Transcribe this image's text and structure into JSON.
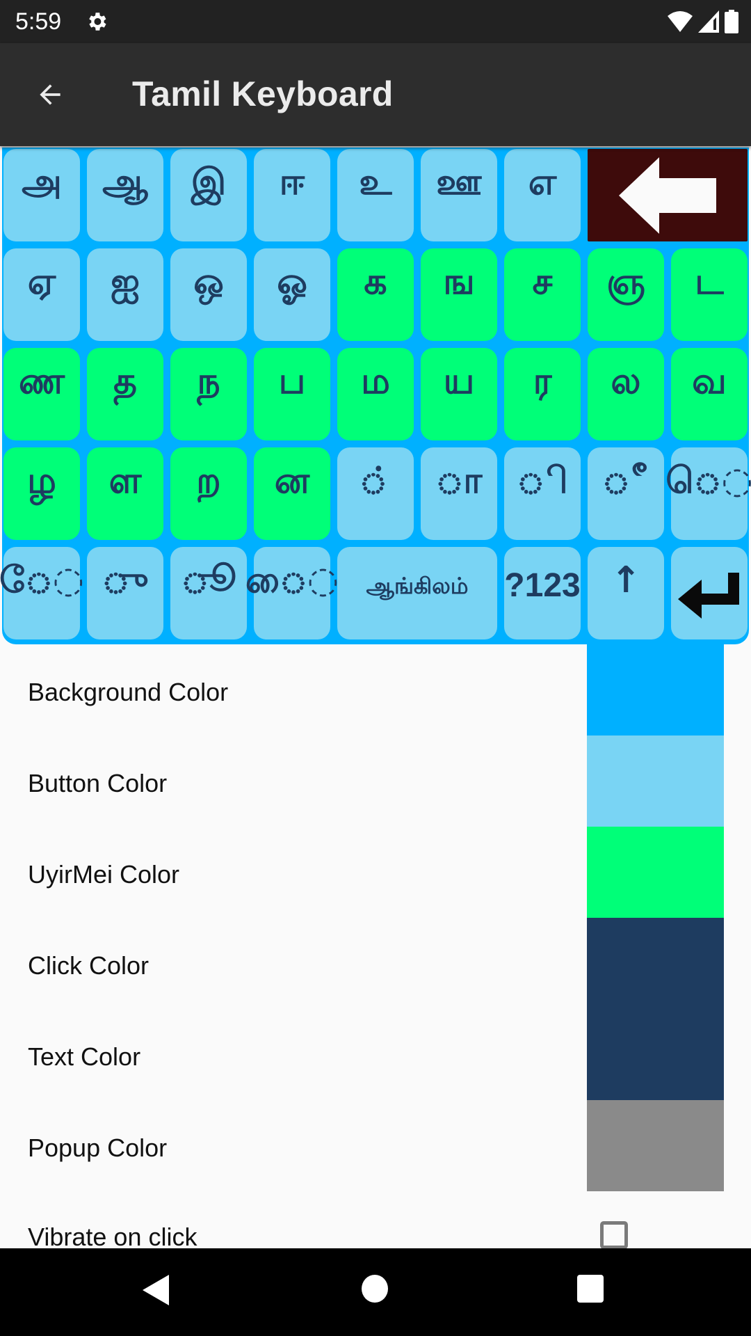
{
  "status_bar": {
    "time": "5:59",
    "icons": [
      "settings-gear-icon",
      "wifi-icon",
      "cell-signal-icon",
      "battery-icon"
    ]
  },
  "toolbar": {
    "title": "Tamil Keyboard",
    "back_icon": "arrow-back-icon"
  },
  "keyboard": {
    "rows": [
      [
        {
          "label": "அ",
          "type": "vowel"
        },
        {
          "label": "ஆ",
          "type": "vowel"
        },
        {
          "label": "இ",
          "type": "vowel"
        },
        {
          "label": "ஈ",
          "type": "vowel"
        },
        {
          "label": "உ",
          "type": "vowel"
        },
        {
          "label": "ஊ",
          "type": "vowel"
        },
        {
          "label": "எ",
          "type": "vowel"
        },
        {
          "label": "",
          "type": "delete",
          "icon": "backspace-arrow-icon"
        }
      ],
      [
        {
          "label": "ஏ",
          "type": "vowel"
        },
        {
          "label": "ஐ",
          "type": "vowel"
        },
        {
          "label": "ஒ",
          "type": "vowel"
        },
        {
          "label": "ஓ",
          "type": "vowel"
        },
        {
          "label": "க",
          "type": "uyirmei"
        },
        {
          "label": "ங",
          "type": "uyirmei"
        },
        {
          "label": "ச",
          "type": "uyirmei"
        },
        {
          "label": "ஞ",
          "type": "uyirmei"
        },
        {
          "label": "ட",
          "type": "uyirmei"
        }
      ],
      [
        {
          "label": "ண",
          "type": "uyirmei"
        },
        {
          "label": "த",
          "type": "uyirmei"
        },
        {
          "label": "ந",
          "type": "uyirmei"
        },
        {
          "label": "ப",
          "type": "uyirmei"
        },
        {
          "label": "ம",
          "type": "uyirmei"
        },
        {
          "label": "ய",
          "type": "uyirmei"
        },
        {
          "label": "ர",
          "type": "uyirmei"
        },
        {
          "label": "ல",
          "type": "uyirmei"
        },
        {
          "label": "வ",
          "type": "uyirmei"
        }
      ],
      [
        {
          "label": "ழ",
          "type": "uyirmei"
        },
        {
          "label": "ள",
          "type": "uyirmei"
        },
        {
          "label": "ற",
          "type": "uyirmei"
        },
        {
          "label": "ன",
          "type": "uyirmei"
        },
        {
          "label": "◌்",
          "type": "sign"
        },
        {
          "label": "◌ா",
          "type": "sign"
        },
        {
          "label": "◌ி",
          "type": "sign"
        },
        {
          "label": "◌ீ",
          "type": "sign"
        },
        {
          "label": "ெ◌",
          "type": "sign"
        }
      ],
      [
        {
          "label": "ே◌",
          "type": "sign"
        },
        {
          "label": "◌ு",
          "type": "sign"
        },
        {
          "label": "◌ூ",
          "type": "sign"
        },
        {
          "label": "ை◌",
          "type": "sign"
        },
        {
          "label": "ஆங்கிலம்",
          "type": "lang",
          "span": 2
        },
        {
          "label": "?123",
          "type": "symbols"
        },
        {
          "label": "↑",
          "type": "shift"
        },
        {
          "label": "",
          "type": "enter",
          "icon": "enter-return-icon"
        }
      ]
    ]
  },
  "settings": [
    {
      "label": "Background Color",
      "color": "#00b0ff"
    },
    {
      "label": "Button Color",
      "color": "#79d4f4"
    },
    {
      "label": "UyirMei Color",
      "color": "#00ff78"
    },
    {
      "label": "Click Color",
      "color": "#1e3c60"
    },
    {
      "label": "Text Color",
      "color": "#1e3c60"
    },
    {
      "label": "Popup Color",
      "color": "#8a8a8a"
    }
  ],
  "vibrate": {
    "label": "Vibrate on click",
    "checked": false
  },
  "colors": {
    "vowel_key": "#79d4f4",
    "uyirmei_key": "#00ff78",
    "keyboard_bg": "#00b0ff",
    "key_text": "#1e3c60",
    "delete_key": "#3e0b0b",
    "toolbar": "#2d2d2d",
    "status_bar": "#222222"
  },
  "nav_bar": {
    "icons": [
      "nav-back-icon",
      "nav-home-icon",
      "nav-recents-icon"
    ]
  }
}
